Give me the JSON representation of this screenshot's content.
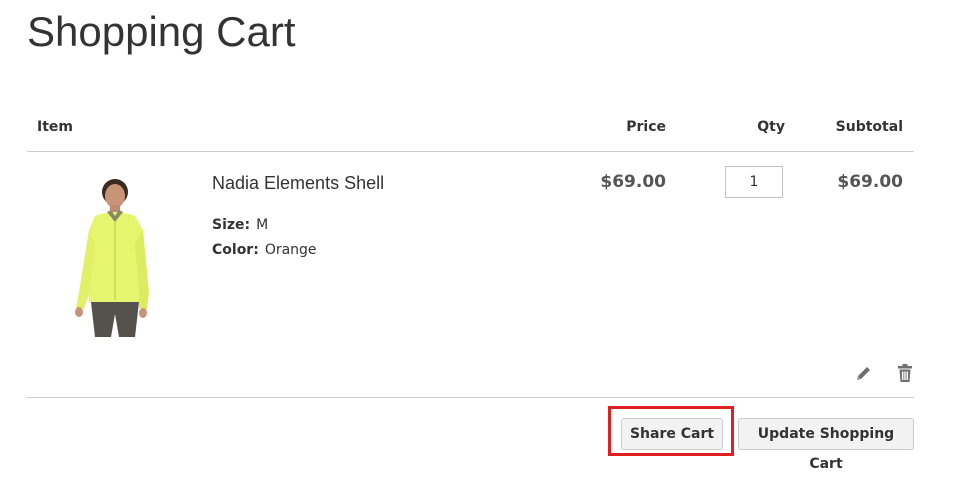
{
  "page": {
    "title": "Shopping Cart"
  },
  "table": {
    "headers": {
      "item": "Item",
      "price": "Price",
      "qty": "Qty",
      "subtotal": "Subtotal"
    }
  },
  "cart": {
    "items": [
      {
        "name": "Nadia Elements Shell",
        "options": [
          {
            "label": "Size:",
            "value": "M"
          },
          {
            "label": "Color:",
            "value": "Orange"
          }
        ],
        "price": "$69.00",
        "qty": "1",
        "subtotal": "$69.00",
        "image_icon": "product-photo-yellow-jacket"
      }
    ]
  },
  "actions": {
    "edit_icon": "pencil-icon",
    "delete_icon": "trash-icon",
    "share_label": "Share Cart",
    "update_label": "Update Shopping Cart"
  },
  "colors": {
    "highlight_border": "#e02020",
    "product_jacket": "#e6f56e",
    "button_bg": "#f2f2f2"
  }
}
